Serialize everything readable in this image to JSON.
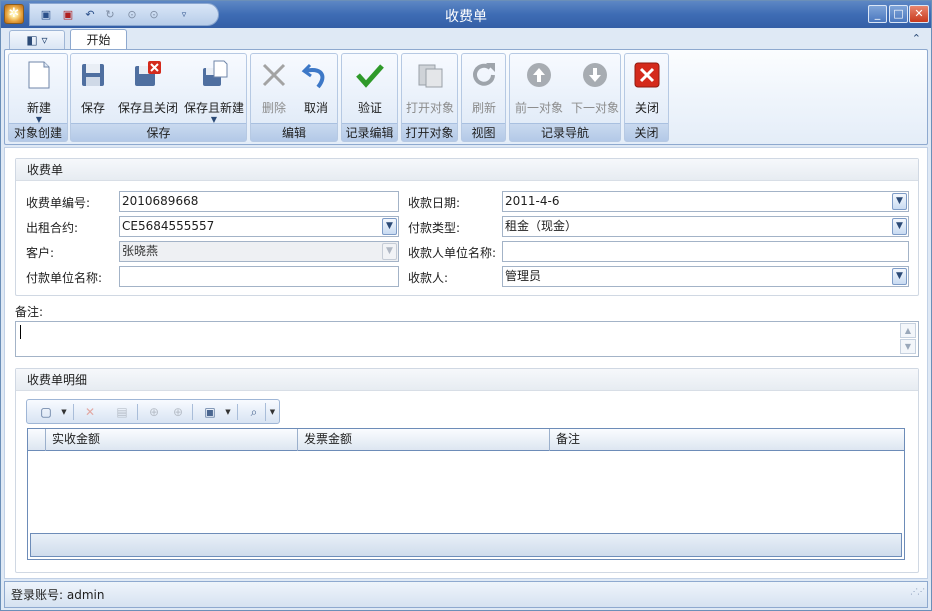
{
  "window": {
    "title": "收费单"
  },
  "ribbon": {
    "tab_start": "开始",
    "groups": {
      "create": "对象创建",
      "save": "保存",
      "edit": "编辑",
      "record_edit": "记录编辑",
      "open_object": "打开对象",
      "view": "视图",
      "record_nav": "记录导航",
      "close": "关闭"
    },
    "buttons": {
      "new": "新建",
      "save": "保存",
      "save_close": "保存且关闭",
      "save_new": "保存且新建",
      "delete": "删除",
      "cancel": "取消",
      "validate": "验证",
      "open_object": "打开对象",
      "refresh": "刷新",
      "prev": "前一对象",
      "next": "下一对象",
      "close": "关闭"
    }
  },
  "form": {
    "section_title": "收费单",
    "fields": {
      "bill_no": {
        "label": "收费单编号:",
        "value": "2010689668"
      },
      "date": {
        "label": "收款日期:",
        "value": "2011-4-6"
      },
      "contract": {
        "label": "出租合约:",
        "value": "CE5684555557"
      },
      "pay_type": {
        "label": "付款类型:",
        "value": "租金（现金）"
      },
      "customer": {
        "label": "客户:",
        "value": "张晓燕"
      },
      "payee_unit": {
        "label": "收款人单位名称:",
        "value": ""
      },
      "payer_unit": {
        "label": "付款单位名称:",
        "value": ""
      },
      "payee": {
        "label": "收款人:",
        "value": "管理员"
      }
    },
    "remarks_label": "备注:",
    "remarks_value": ""
  },
  "details": {
    "section_title": "收费单明细",
    "columns": [
      "实收金额",
      "发票金额",
      "备注"
    ]
  },
  "status": {
    "text": "登录账号: admin"
  }
}
